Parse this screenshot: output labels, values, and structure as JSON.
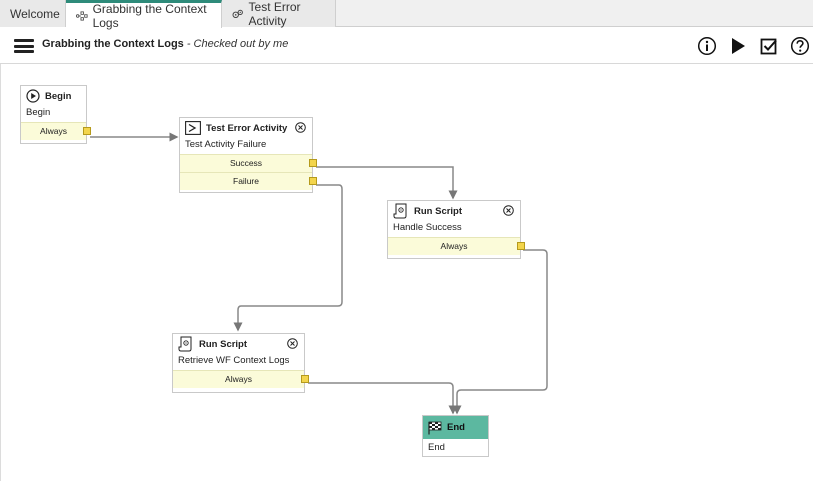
{
  "tabs": [
    {
      "label": "Welcome"
    },
    {
      "label": "Grabbing the Context Logs",
      "icon": "workflow-icon",
      "active": true
    },
    {
      "label": "Test Error Activity",
      "icon": "gears-icon"
    }
  ],
  "header": {
    "title": "Grabbing the Context Logs",
    "status": " - Checked out by me",
    "icons": [
      "info-icon",
      "play-icon",
      "checkbox-icon",
      "help-icon"
    ]
  },
  "nodes": {
    "begin": {
      "title": "Begin",
      "subtitle": "Begin",
      "conditions": [
        "Always"
      ]
    },
    "test_error": {
      "title": "Test Error Activity",
      "subtitle": "Test Activity Failure",
      "conditions": [
        "Success",
        "Failure"
      ]
    },
    "run_success": {
      "title": "Run Script",
      "subtitle": "Handle Success",
      "conditions": [
        "Always"
      ]
    },
    "run_retrieve": {
      "title": "Run Script",
      "subtitle": "Retrieve WF Context Logs",
      "conditions": [
        "Always"
      ]
    },
    "end": {
      "title": "End",
      "subtitle": "End"
    }
  },
  "colors": {
    "accent": "#2e8b7a",
    "end_header": "#5cb8a0",
    "condition_bg": "#fbfbd9",
    "port": "#f3d54c"
  }
}
